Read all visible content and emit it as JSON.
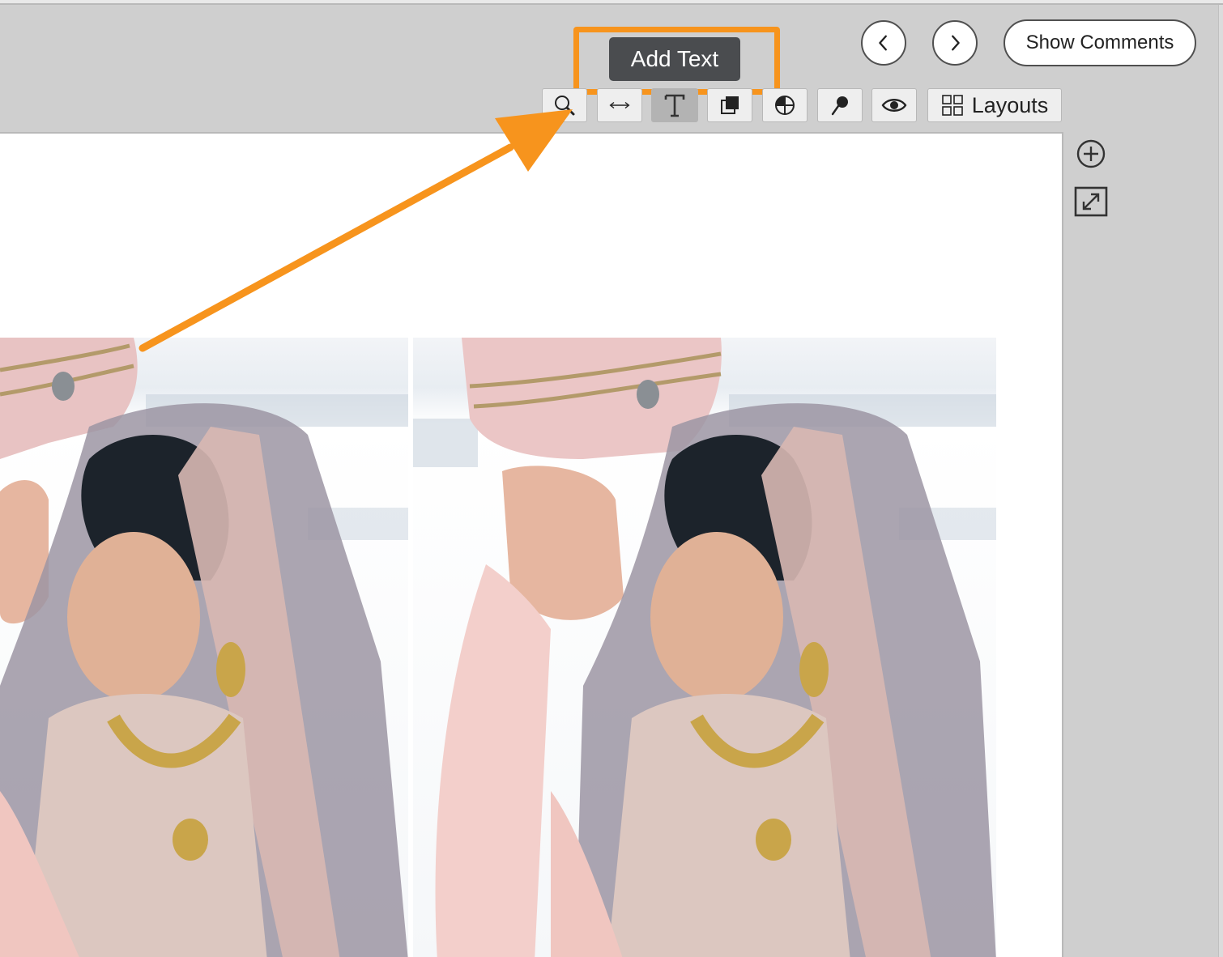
{
  "toolbar": {
    "tooltip": "Add Text",
    "show_comments_label": "Show Comments",
    "layouts_label": "Layouts",
    "tools": [
      {
        "name": "zoom-tool",
        "icon": "magnifier-icon"
      },
      {
        "name": "resize-tool",
        "icon": "horizontal-arrows-icon"
      },
      {
        "name": "text-tool",
        "icon": "text-t-icon",
        "active": true
      },
      {
        "name": "layer-tool",
        "icon": "stacked-squares-icon"
      },
      {
        "name": "color-tool",
        "icon": "circle-quadrant-icon"
      },
      {
        "name": "pin-tool",
        "icon": "pin-icon"
      },
      {
        "name": "preview-tool",
        "icon": "eye-icon"
      },
      {
        "name": "layouts-tool",
        "icon": "grid-icon"
      }
    ]
  },
  "navigation": {
    "prev_icon": "chevron-left-icon",
    "next_icon": "chevron-right-icon"
  },
  "side_controls": {
    "zoom_icon": "plus-circle-icon",
    "fullscreen_icon": "expand-icon"
  },
  "annotation": {
    "highlight_color": "#f7941d",
    "arrow_color": "#f7941d"
  },
  "canvas": {
    "photos": [
      "wedding-couple-photo",
      "wedding-couple-photo"
    ]
  }
}
